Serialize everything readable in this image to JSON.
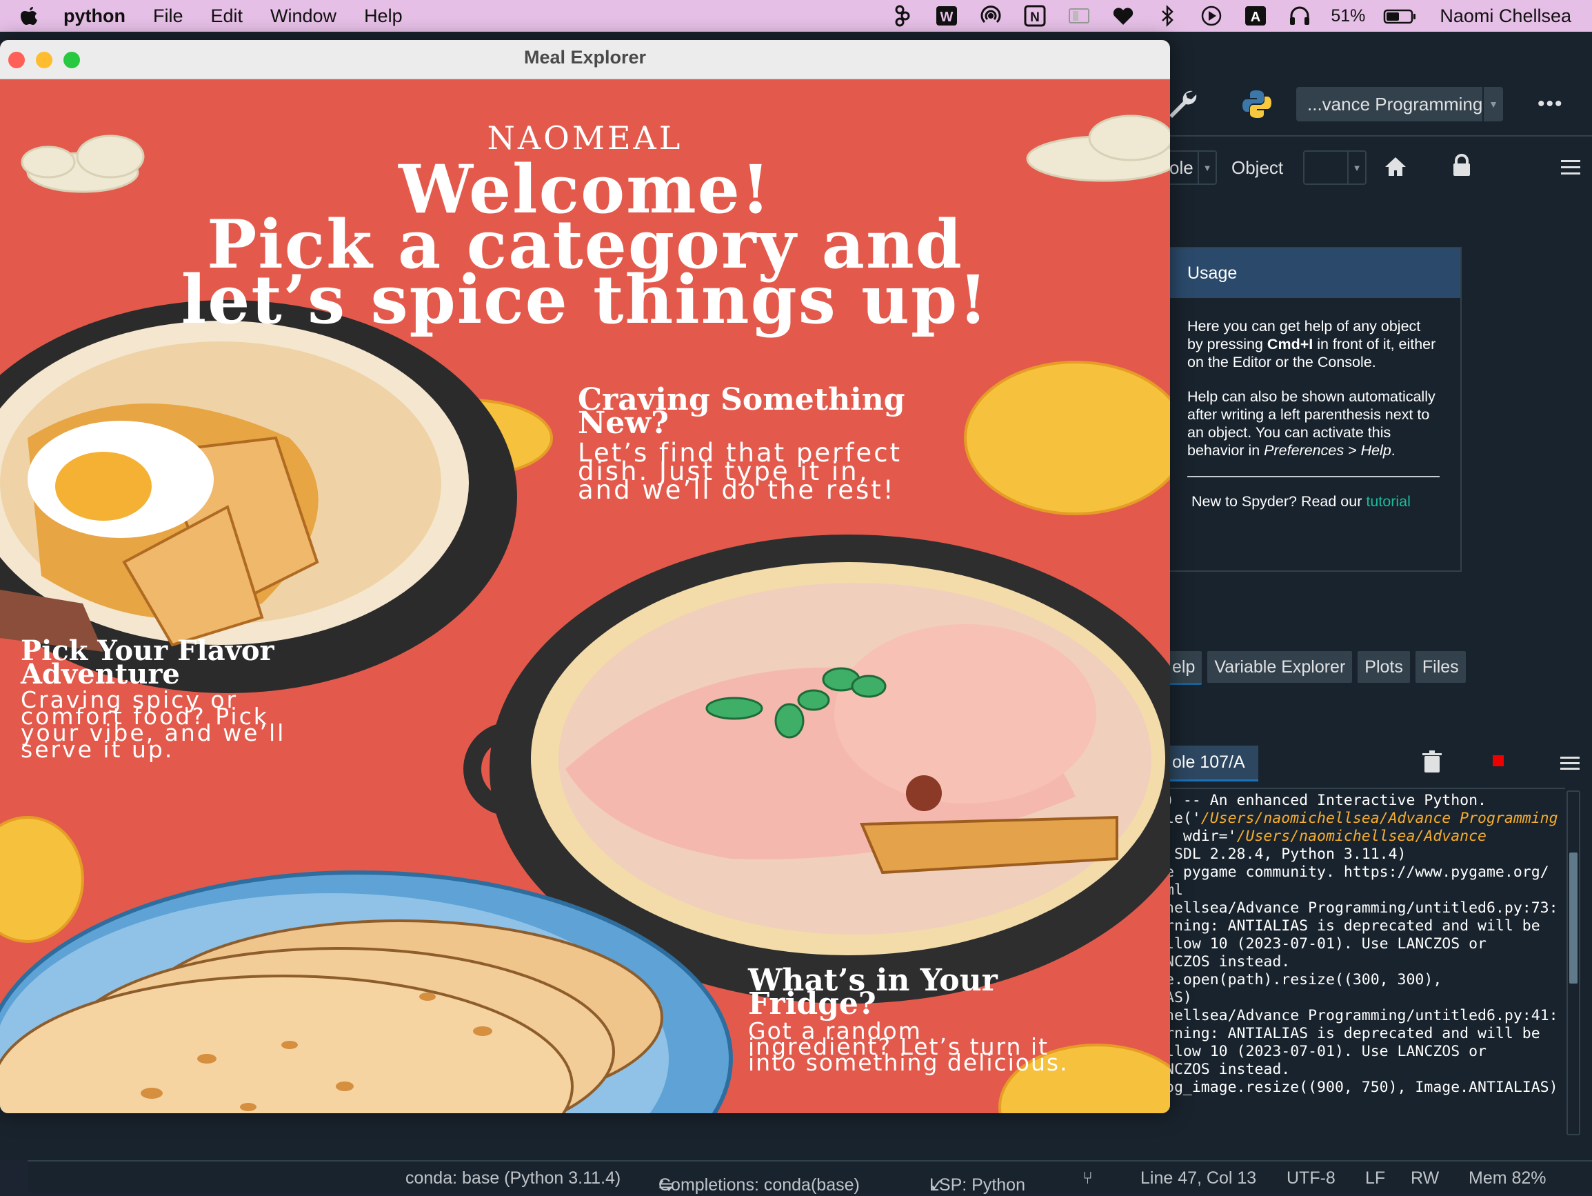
{
  "menubar": {
    "app_name": "python",
    "items": [
      "File",
      "Edit",
      "Window",
      "Help"
    ],
    "battery": "51%",
    "user": "Naomi Chellsea",
    "status_icons": [
      "figma-icon",
      "wps-icon",
      "airdrop-icon",
      "notion-icon",
      "display-icon",
      "heart-icon",
      "bluetooth-icon",
      "play-icon",
      "input-source-icon",
      "headphones-icon"
    ]
  },
  "spyder": {
    "project": "...vance Programming",
    "source_combo": "ole",
    "object_label": "Object",
    "usage": {
      "title": "Usage",
      "p1_a": "Here you can get help of any object by pressing ",
      "p1_bold": "Cmd+I",
      "p1_b": " in front of it, either on the Editor or the Console.",
      "p2_a": "Help can also be shown automatically after writing a left parenthesis next to an object. You can activate this behavior in ",
      "p2_italic": "Preferences > Help",
      "p2_b": ".",
      "tutorial_prefix": "New to Spyder? Read our ",
      "tutorial_link": "tutorial"
    },
    "pane_tabs": [
      "elp",
      "Variable Explorer",
      "Plots",
      "Files"
    ],
    "console_tab": "ole 107/A",
    "console_lines": [
      ") -- An enhanced Interactive Python.",
      "",
      "le('",
      "  wdir='",
      "",
      " SDL 2.28.4, Python 3.11.4)",
      "e pygame community. https://www.pygame.org/",
      "ml",
      "hellsea/Advance Programming/untitled6.py:73:",
      "rning: ANTIALIAS is deprecated and will be",
      "llow 10 (2023-07-01). Use LANCZOS or",
      "NCZOS instead.",
      "e.open(path).resize((300, 300),",
      "AS)",
      "hellsea/Advance Programming/untitled6.py:41:",
      "rning: ANTIALIAS is deprecated and will be",
      "llow 10 (2023-07-01). Use LANCZOS or",
      "NCZOS instead.",
      "og_image.resize((900, 750), Image.ANTIALIAS)"
    ],
    "console_path1": "/Users/naomichellsea/Advance Programming",
    "console_path2": "/Users/naomichellsea/Advance",
    "status": {
      "env": "conda: base (Python 3.11.4)",
      "completions": "Completions: conda(base)",
      "lsp": "LSP: Python",
      "position": "Line 47, Col 13",
      "encoding": "UTF-8",
      "eol": "LF",
      "mode": "RW",
      "mem": "Mem 82%"
    }
  },
  "meal": {
    "window_title": "Meal Explorer",
    "brand": "NAOMEAL",
    "headline_1": "Welcome!",
    "headline_2": "Pick a category and",
    "headline_3": "let’s spice things up!",
    "craving": {
      "title_1": "Craving Something",
      "title_2": "New?",
      "body_1": "Let’s find that perfect",
      "body_2": "dish. Just type it in,",
      "body_3": "and we’ll do the rest!"
    },
    "flavor": {
      "title_1": "Pick Your Flavor",
      "title_2": "Adventure",
      "body_1": "Craving spicy or",
      "body_2": "comfort food? Pick",
      "body_3": "your vibe, and we’ll",
      "body_4": "serve it up."
    },
    "fridge": {
      "title_1": "What’s in Your",
      "title_2": "Fridge?",
      "body_1": "Got a random",
      "body_2": "ingredient? Let’s turn it",
      "body_3": "into something delicious."
    }
  },
  "colors": {
    "poster_red": "#e35a4c",
    "menubar": "#e6bfe6",
    "spyder_bg": "#19232d",
    "link": "#1abc9c",
    "path": "#f6ad2e"
  }
}
